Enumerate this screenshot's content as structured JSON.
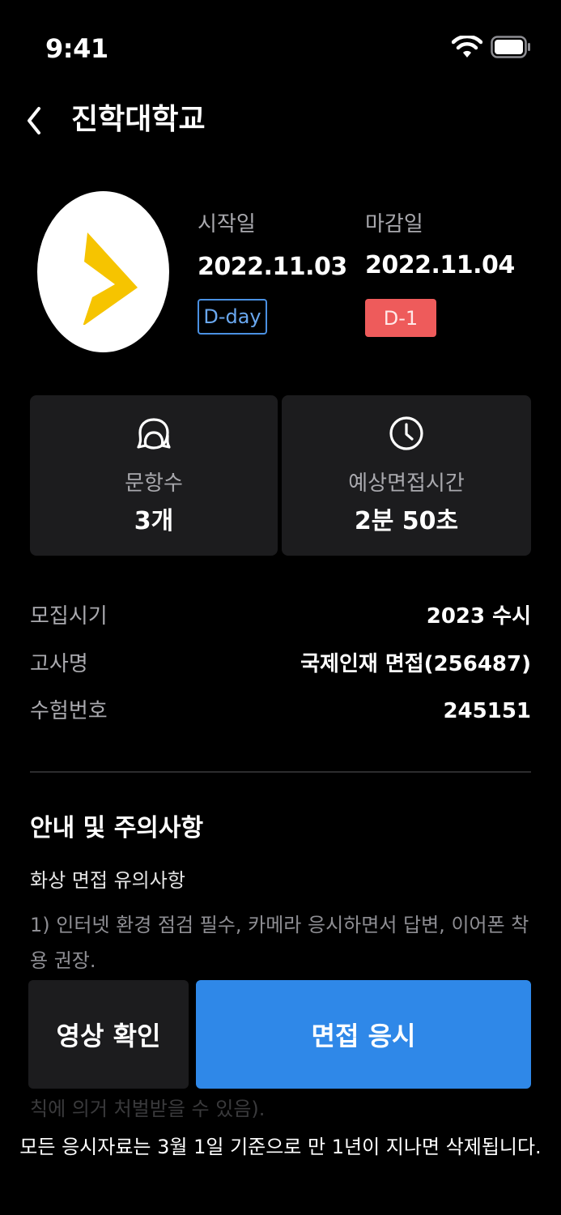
{
  "status_bar": {
    "time": "9:41"
  },
  "header": {
    "title": "진학대학교"
  },
  "schedule": {
    "start_label": "시작일",
    "start_date": "2022.11.03",
    "start_badge": "D-day",
    "end_label": "마감일",
    "end_date": "2022.11.04",
    "end_badge": "D-1"
  },
  "stats": [
    {
      "icon": "chat-bubbles-icon",
      "label": "문항수",
      "value": "3개"
    },
    {
      "icon": "clock-icon",
      "label": "예상면접시간",
      "value": "2분 50초"
    }
  ],
  "info": [
    {
      "label": "모집시기",
      "value": "2023 수시"
    },
    {
      "label": "고사명",
      "value": "국제인재 면접(256487)"
    },
    {
      "label": "수험번호",
      "value": "245151"
    }
  ],
  "notice": {
    "section_title": "안내 및 주의사항",
    "title": "화상 면접 유의사항",
    "body": "1) 인터넷 환경 점검 필수, 카메라 응시하면서 답변, 이어폰 착용 권장.",
    "tail": "칙에 의거 처벌받을 수 있음)."
  },
  "buttons": {
    "video": "영상 확인",
    "interview": "면접 응시"
  },
  "footer": {
    "note": "모든 응시자료는 3월 1일 기준으로 만 1년이 지나면 삭제됩니다."
  },
  "colors": {
    "background": "#000000",
    "card": "#1c1c1e",
    "primary": "#2f88e8",
    "danger": "#ee5b5b",
    "dday_border": "#4a90e2",
    "logo_yellow": "#f6c400"
  }
}
